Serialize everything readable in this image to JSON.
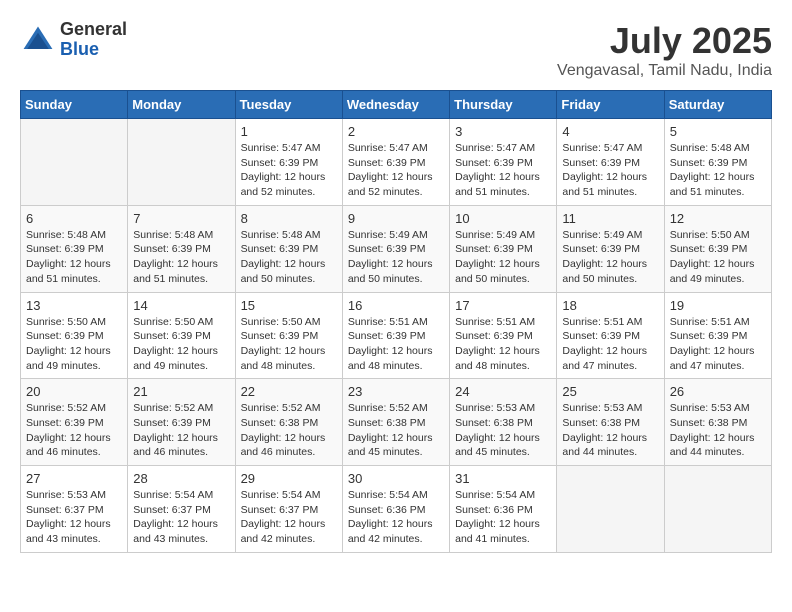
{
  "header": {
    "logo_general": "General",
    "logo_blue": "Blue",
    "month_title": "July 2025",
    "location": "Vengavasal, Tamil Nadu, India"
  },
  "days_of_week": [
    "Sunday",
    "Monday",
    "Tuesday",
    "Wednesday",
    "Thursday",
    "Friday",
    "Saturday"
  ],
  "weeks": [
    [
      {
        "day": "",
        "sunrise": "",
        "sunset": "",
        "daylight": ""
      },
      {
        "day": "",
        "sunrise": "",
        "sunset": "",
        "daylight": ""
      },
      {
        "day": "1",
        "sunrise": "Sunrise: 5:47 AM",
        "sunset": "Sunset: 6:39 PM",
        "daylight": "Daylight: 12 hours and 52 minutes."
      },
      {
        "day": "2",
        "sunrise": "Sunrise: 5:47 AM",
        "sunset": "Sunset: 6:39 PM",
        "daylight": "Daylight: 12 hours and 52 minutes."
      },
      {
        "day": "3",
        "sunrise": "Sunrise: 5:47 AM",
        "sunset": "Sunset: 6:39 PM",
        "daylight": "Daylight: 12 hours and 51 minutes."
      },
      {
        "day": "4",
        "sunrise": "Sunrise: 5:47 AM",
        "sunset": "Sunset: 6:39 PM",
        "daylight": "Daylight: 12 hours and 51 minutes."
      },
      {
        "day": "5",
        "sunrise": "Sunrise: 5:48 AM",
        "sunset": "Sunset: 6:39 PM",
        "daylight": "Daylight: 12 hours and 51 minutes."
      }
    ],
    [
      {
        "day": "6",
        "sunrise": "Sunrise: 5:48 AM",
        "sunset": "Sunset: 6:39 PM",
        "daylight": "Daylight: 12 hours and 51 minutes."
      },
      {
        "day": "7",
        "sunrise": "Sunrise: 5:48 AM",
        "sunset": "Sunset: 6:39 PM",
        "daylight": "Daylight: 12 hours and 51 minutes."
      },
      {
        "day": "8",
        "sunrise": "Sunrise: 5:48 AM",
        "sunset": "Sunset: 6:39 PM",
        "daylight": "Daylight: 12 hours and 50 minutes."
      },
      {
        "day": "9",
        "sunrise": "Sunrise: 5:49 AM",
        "sunset": "Sunset: 6:39 PM",
        "daylight": "Daylight: 12 hours and 50 minutes."
      },
      {
        "day": "10",
        "sunrise": "Sunrise: 5:49 AM",
        "sunset": "Sunset: 6:39 PM",
        "daylight": "Daylight: 12 hours and 50 minutes."
      },
      {
        "day": "11",
        "sunrise": "Sunrise: 5:49 AM",
        "sunset": "Sunset: 6:39 PM",
        "daylight": "Daylight: 12 hours and 50 minutes."
      },
      {
        "day": "12",
        "sunrise": "Sunrise: 5:50 AM",
        "sunset": "Sunset: 6:39 PM",
        "daylight": "Daylight: 12 hours and 49 minutes."
      }
    ],
    [
      {
        "day": "13",
        "sunrise": "Sunrise: 5:50 AM",
        "sunset": "Sunset: 6:39 PM",
        "daylight": "Daylight: 12 hours and 49 minutes."
      },
      {
        "day": "14",
        "sunrise": "Sunrise: 5:50 AM",
        "sunset": "Sunset: 6:39 PM",
        "daylight": "Daylight: 12 hours and 49 minutes."
      },
      {
        "day": "15",
        "sunrise": "Sunrise: 5:50 AM",
        "sunset": "Sunset: 6:39 PM",
        "daylight": "Daylight: 12 hours and 48 minutes."
      },
      {
        "day": "16",
        "sunrise": "Sunrise: 5:51 AM",
        "sunset": "Sunset: 6:39 PM",
        "daylight": "Daylight: 12 hours and 48 minutes."
      },
      {
        "day": "17",
        "sunrise": "Sunrise: 5:51 AM",
        "sunset": "Sunset: 6:39 PM",
        "daylight": "Daylight: 12 hours and 48 minutes."
      },
      {
        "day": "18",
        "sunrise": "Sunrise: 5:51 AM",
        "sunset": "Sunset: 6:39 PM",
        "daylight": "Daylight: 12 hours and 47 minutes."
      },
      {
        "day": "19",
        "sunrise": "Sunrise: 5:51 AM",
        "sunset": "Sunset: 6:39 PM",
        "daylight": "Daylight: 12 hours and 47 minutes."
      }
    ],
    [
      {
        "day": "20",
        "sunrise": "Sunrise: 5:52 AM",
        "sunset": "Sunset: 6:39 PM",
        "daylight": "Daylight: 12 hours and 46 minutes."
      },
      {
        "day": "21",
        "sunrise": "Sunrise: 5:52 AM",
        "sunset": "Sunset: 6:39 PM",
        "daylight": "Daylight: 12 hours and 46 minutes."
      },
      {
        "day": "22",
        "sunrise": "Sunrise: 5:52 AM",
        "sunset": "Sunset: 6:38 PM",
        "daylight": "Daylight: 12 hours and 46 minutes."
      },
      {
        "day": "23",
        "sunrise": "Sunrise: 5:52 AM",
        "sunset": "Sunset: 6:38 PM",
        "daylight": "Daylight: 12 hours and 45 minutes."
      },
      {
        "day": "24",
        "sunrise": "Sunrise: 5:53 AM",
        "sunset": "Sunset: 6:38 PM",
        "daylight": "Daylight: 12 hours and 45 minutes."
      },
      {
        "day": "25",
        "sunrise": "Sunrise: 5:53 AM",
        "sunset": "Sunset: 6:38 PM",
        "daylight": "Daylight: 12 hours and 44 minutes."
      },
      {
        "day": "26",
        "sunrise": "Sunrise: 5:53 AM",
        "sunset": "Sunset: 6:38 PM",
        "daylight": "Daylight: 12 hours and 44 minutes."
      }
    ],
    [
      {
        "day": "27",
        "sunrise": "Sunrise: 5:53 AM",
        "sunset": "Sunset: 6:37 PM",
        "daylight": "Daylight: 12 hours and 43 minutes."
      },
      {
        "day": "28",
        "sunrise": "Sunrise: 5:54 AM",
        "sunset": "Sunset: 6:37 PM",
        "daylight": "Daylight: 12 hours and 43 minutes."
      },
      {
        "day": "29",
        "sunrise": "Sunrise: 5:54 AM",
        "sunset": "Sunset: 6:37 PM",
        "daylight": "Daylight: 12 hours and 42 minutes."
      },
      {
        "day": "30",
        "sunrise": "Sunrise: 5:54 AM",
        "sunset": "Sunset: 6:36 PM",
        "daylight": "Daylight: 12 hours and 42 minutes."
      },
      {
        "day": "31",
        "sunrise": "Sunrise: 5:54 AM",
        "sunset": "Sunset: 6:36 PM",
        "daylight": "Daylight: 12 hours and 41 minutes."
      },
      {
        "day": "",
        "sunrise": "",
        "sunset": "",
        "daylight": ""
      },
      {
        "day": "",
        "sunrise": "",
        "sunset": "",
        "daylight": ""
      }
    ]
  ]
}
